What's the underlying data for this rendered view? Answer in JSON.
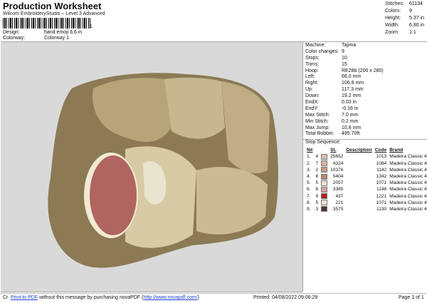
{
  "header": {
    "title": "Production Worksheet",
    "subtitle": "Wilcom EmbroideryStudio – Level 3 Advanced",
    "barcode_digit": "1",
    "design_label": "Design:",
    "design_value": "hand emoji 6,6 in",
    "colorway_label": "Colorway:",
    "colorway_value": "Colorway 1"
  },
  "summary": [
    {
      "label": "Stitches:",
      "value": "61134"
    },
    {
      "label": "Colors:",
      "value": "9"
    },
    {
      "label": "Height:",
      "value": "5.37 in"
    },
    {
      "label": "Width:",
      "value": "6.80 in"
    },
    {
      "label": "Zoom:",
      "value": "1:1"
    }
  ],
  "machine_info": [
    {
      "label": "Machine:",
      "value": "Tajima"
    },
    {
      "label": "Color changes:",
      "value": "9"
    },
    {
      "label": "Stops:",
      "value": "10"
    },
    {
      "label": "Trims:",
      "value": "15"
    },
    {
      "label": "Hoop:",
      "value": "RE28b (200 x 280)"
    },
    {
      "label": "Left:",
      "value": "66.0 mm"
    },
    {
      "label": "Right:",
      "value": "106.8 mm"
    },
    {
      "label": "Up:",
      "value": "117.3 mm"
    },
    {
      "label": "Down:",
      "value": "19.2 mm"
    },
    {
      "label": "EndX:",
      "value": "0.03 in"
    },
    {
      "label": "EndY:",
      "value": "-0.16 in"
    },
    {
      "label": "Max Stitch:",
      "value": "7.0 mm"
    },
    {
      "label": "Min Stitch:",
      "value": "0.2 mm"
    },
    {
      "label": "Max Jump:",
      "value": "10.8 mm"
    },
    {
      "label": "Total Bobbin:",
      "value": "495.70ft"
    }
  ],
  "stop_sequence": {
    "title": "Stop Sequence:",
    "headers": [
      "N#",
      "",
      "St.",
      "Description",
      "Code",
      "Brand"
    ],
    "rows": [
      {
        "n": "1.",
        "num": "4",
        "color": "#d9c0b0",
        "st": "25652",
        "desc": "",
        "code": "1013",
        "brand": "Madeira Classic 40"
      },
      {
        "n": "2.",
        "num": "7",
        "color": "#d8b2a0",
        "st": "4324",
        "desc": "",
        "code": "1084",
        "brand": "Madeira Classic 40"
      },
      {
        "n": "3.",
        "num": "2",
        "color": "#c59a82",
        "st": "10376",
        "desc": "",
        "code": "1142",
        "brand": "Madeira Classic 40"
      },
      {
        "n": "4.",
        "num": "8",
        "color": "#b88a72",
        "st": "5404",
        "desc": "",
        "code": "1342",
        "brand": "Madeira Classic 40"
      },
      {
        "n": "5.",
        "num": "5",
        "color": "#ece4d4",
        "st": "2057",
        "desc": "",
        "code": "1071",
        "brand": "Madeira Classic 40"
      },
      {
        "n": "6.",
        "num": "6",
        "color": "#dca0a0",
        "st": "3385",
        "desc": "",
        "code": "1148",
        "brand": "Madeira Classic 40"
      },
      {
        "n": "7.",
        "num": "9",
        "color": "#b02020",
        "st": "437",
        "desc": "",
        "code": "1221",
        "brand": "Madeira Classic 40"
      },
      {
        "n": "8.",
        "num": "5",
        "color": "#ece4d4",
        "st": "221",
        "desc": "",
        "code": "1071",
        "brand": "Madeira Classic 40"
      },
      {
        "n": "9.",
        "num": "3",
        "color": "#4a3a30",
        "st": "3575",
        "desc": "",
        "code": "1130",
        "brand": "Madeira Classic 40"
      }
    ]
  },
  "footer": {
    "prefix": "Cr",
    "print_link": "Print to PDF",
    "message": " without this message by purchasing novaPDF (",
    "url": "http://www.novapdf.com/",
    "close": ")",
    "printed": "Printed: 04/08/2022 09:06:29",
    "page": "Page 1 of 1"
  },
  "colors": {
    "canvas_bg": "#d9d9d9",
    "skin_dark": "#8c7a55",
    "skin_mid": "#b6a47a",
    "skin_light": "#d8caa4",
    "ring_red": "#b06560"
  }
}
